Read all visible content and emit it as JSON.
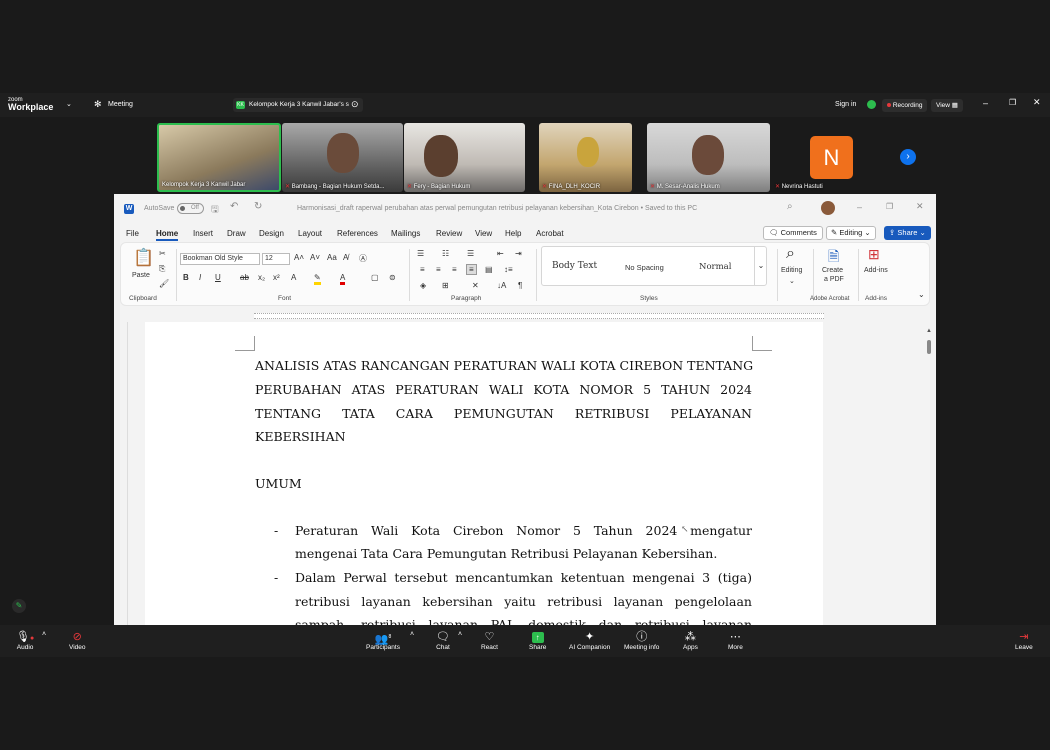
{
  "zoom_top": {
    "logo_small": "zoom",
    "logo_big": "Workplace",
    "meeting": "Meeting",
    "tab_title": "Kelompok Kerja 3 Kanwil Jabar's s",
    "tab_avatar": "KK",
    "sign_in": "Sign in",
    "recording": "Recording",
    "view": "View"
  },
  "gallery": [
    {
      "name": "Kelompok Kerja 3 Kanwil Jabar"
    },
    {
      "name": "Bambang - Bagian Hukum Setda..."
    },
    {
      "name": "Fery - Bagian Hukum"
    },
    {
      "name": "FINA_DLH_KOCIR"
    },
    {
      "name": "M. Sesar-Analis Hukum"
    },
    {
      "name": "Nevrina Hastuti",
      "initial": "N"
    }
  ],
  "word": {
    "autosave": "AutoSave",
    "autosave_state": "Off",
    "doc_title": "Harmonisasi_draft raperwal perubahan atas perwal pemungutan retribusi pelayanan kebersihan_Kota Cirebon  •  Saved to this PC",
    "tabs": [
      "File",
      "Home",
      "Insert",
      "Draw",
      "Design",
      "Layout",
      "References",
      "Mailings",
      "Review",
      "View",
      "Help",
      "Acrobat"
    ],
    "comments": "Comments",
    "editing_mode": "Editing",
    "share": "Share",
    "ribbon": {
      "paste": "Paste",
      "clipboard": "Clipboard",
      "font_name": "Bookman Old Style",
      "font_size": "12",
      "font": "Font",
      "paragraph": "Paragraph",
      "styles": "Styles",
      "style_items": [
        "Body Text",
        "No Spacing",
        "Normal"
      ],
      "editing": "Editing",
      "create_pdf_1": "Create",
      "create_pdf_2": "a PDF",
      "adobe_acrobat": "Adobe Acrobat",
      "add_ins": "Add-ins",
      "add_ins_group": "Add-ins"
    },
    "document": {
      "heading": [
        "ANALISIS ATAS RANCANGAN PERATURAN WALI KOTA CIREBON TENTANG",
        "PERUBAHAN ATAS PERATURAN WALI KOTA NOMOR 5 TAHUN 2024",
        "TENTANG TATA CARA PEMUNGUTAN RETRIBUSI PELAYANAN",
        "KEBERSIHAN"
      ],
      "section": "UMUM",
      "bullet1": [
        "Peraturan Wali Kota Cirebon Nomor 5 Tahun 2024 mengatur",
        "mengenai Tata Cara Pemungutan Retribusi Pelayanan Kebersihan."
      ],
      "bullet2": [
        "Dalam Perwal tersebut mencantumkan ketentuan mengenai 3 (tiga)",
        "retribusi layanan kebersihan yaitu retribusi layanan pengelolaan",
        "sampah, retribusi layanan PAL domestik dan retribusi layanan"
      ],
      "dash": "-"
    }
  },
  "zoom_bottom": {
    "audio": "Audio",
    "video": "Video",
    "participants": "Participants",
    "participants_count": "8",
    "chat": "Chat",
    "react": "React",
    "share": "Share",
    "ai": "AI Companion",
    "info": "Meeting info",
    "apps": "Apps",
    "more": "More",
    "leave": "Leave"
  },
  "colors": {
    "zoom_green": "#2dbd4e",
    "word_blue": "#185abd",
    "nevrina_orange": "#f0701c",
    "recording_red": "#e5383b"
  }
}
